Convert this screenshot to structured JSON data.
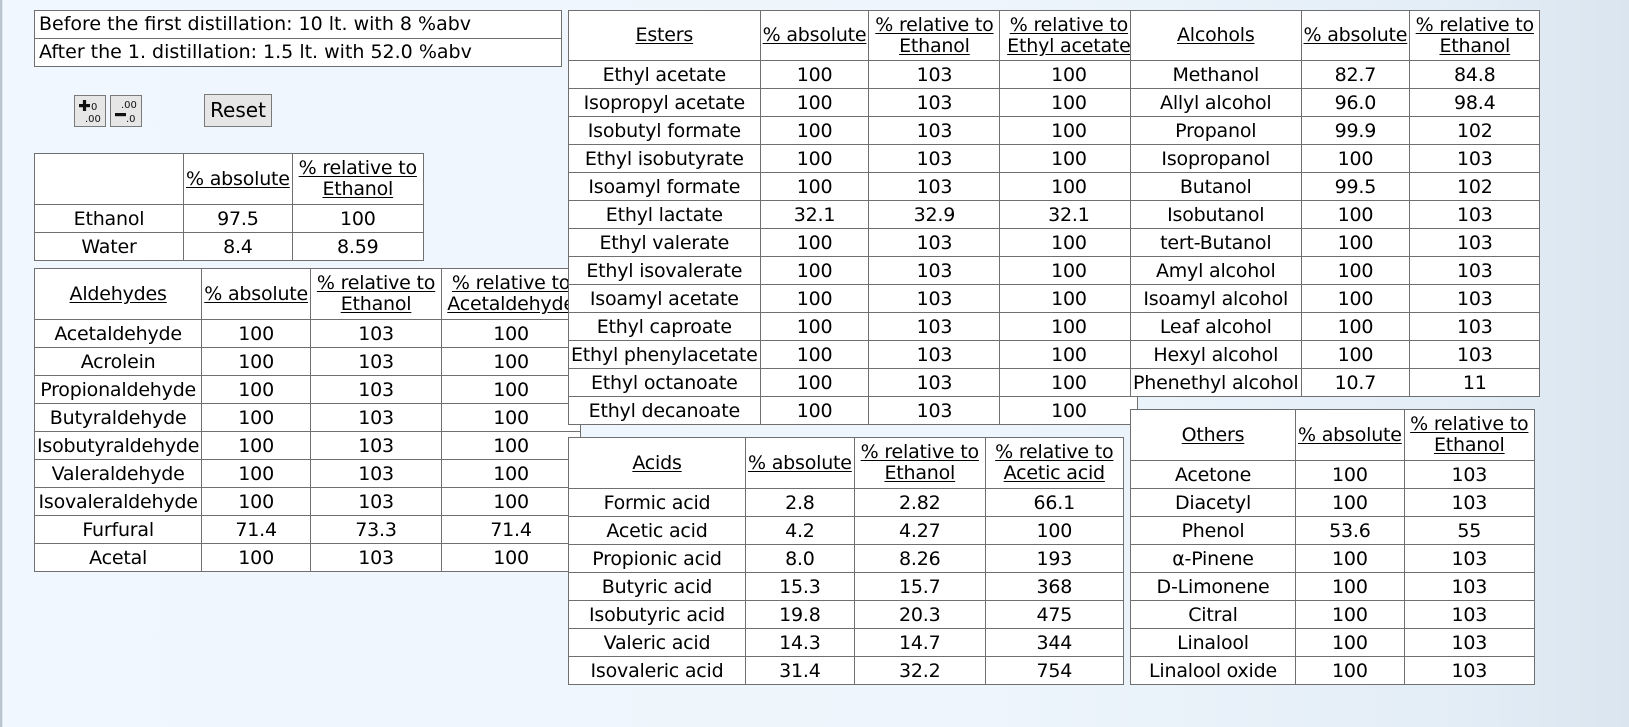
{
  "info": {
    "before": "Before the first distillation: 10 lt. with 8 %abv",
    "after": "After the 1. distillation: 1.5 lt. with 52.0 %abv"
  },
  "toolbar": {
    "increase_decimals_icon": "increase-decimal-icon",
    "decrease_decimals_icon": "decrease-decimal-icon",
    "reset_label": "Reset"
  },
  "ethanol_table": {
    "headers": [
      "",
      "% absolute",
      "% relative to",
      "Ethanol"
    ],
    "rows": [
      [
        "Ethanol",
        "97.5",
        "100"
      ],
      [
        "Water",
        "8.4",
        "8.59"
      ]
    ]
  },
  "aldehydes_table": {
    "title": "Aldehydes",
    "col_absolute": "% absolute",
    "col_rel1_top": "% relative to",
    "col_rel1_bottom": "Ethanol",
    "col_rel2_top": "% relative to",
    "col_rel2_bottom": "Acetaldehyde",
    "rows": [
      [
        "Acetaldehyde",
        "100",
        "103",
        "100"
      ],
      [
        "Acrolein",
        "100",
        "103",
        "100"
      ],
      [
        "Propionaldehyde",
        "100",
        "103",
        "100"
      ],
      [
        "Butyraldehyde",
        "100",
        "103",
        "100"
      ],
      [
        "Isobutyraldehyde",
        "100",
        "103",
        "100"
      ],
      [
        "Valeraldehyde",
        "100",
        "103",
        "100"
      ],
      [
        "Isovaleraldehyde",
        "100",
        "103",
        "100"
      ],
      [
        "Furfural",
        "71.4",
        "73.3",
        "71.4"
      ],
      [
        "Acetal",
        "100",
        "103",
        "100"
      ]
    ]
  },
  "esters_table": {
    "title": "Esters",
    "col_absolute": "% absolute",
    "col_rel1_top": "% relative to",
    "col_rel1_bottom": "Ethanol",
    "col_rel2_top": "% relative to",
    "col_rel2_bottom": "Ethyl acetate",
    "rows": [
      [
        "Ethyl acetate",
        "100",
        "103",
        "100"
      ],
      [
        "Isopropyl acetate",
        "100",
        "103",
        "100"
      ],
      [
        "Isobutyl formate",
        "100",
        "103",
        "100"
      ],
      [
        "Ethyl isobutyrate",
        "100",
        "103",
        "100"
      ],
      [
        "Isoamyl formate",
        "100",
        "103",
        "100"
      ],
      [
        "Ethyl lactate",
        "32.1",
        "32.9",
        "32.1"
      ],
      [
        "Ethyl valerate",
        "100",
        "103",
        "100"
      ],
      [
        "Ethyl isovalerate",
        "100",
        "103",
        "100"
      ],
      [
        "Isoamyl acetate",
        "100",
        "103",
        "100"
      ],
      [
        "Ethyl caproate",
        "100",
        "103",
        "100"
      ],
      [
        "Ethyl phenylacetate",
        "100",
        "103",
        "100"
      ],
      [
        "Ethyl octanoate",
        "100",
        "103",
        "100"
      ],
      [
        "Ethyl decanoate",
        "100",
        "103",
        "100"
      ]
    ]
  },
  "acids_table": {
    "title": "Acids",
    "col_absolute": "% absolute",
    "col_rel1_top": "% relative to",
    "col_rel1_bottom": "Ethanol",
    "col_rel2_top": "% relative to",
    "col_rel2_bottom": "Acetic acid",
    "rows": [
      [
        "Formic acid",
        "2.8",
        "2.82",
        "66.1"
      ],
      [
        "Acetic acid",
        "4.2",
        "4.27",
        "100"
      ],
      [
        "Propionic acid",
        "8.0",
        "8.26",
        "193"
      ],
      [
        "Butyric acid",
        "15.3",
        "15.7",
        "368"
      ],
      [
        "Isobutyric acid",
        "19.8",
        "20.3",
        "475"
      ],
      [
        "Valeric acid",
        "14.3",
        "14.7",
        "344"
      ],
      [
        "Isovaleric acid",
        "31.4",
        "32.2",
        "754"
      ]
    ]
  },
  "alcohols_table": {
    "title": "Alcohols",
    "col_absolute": "% absolute",
    "col_rel1_top": "% relative to",
    "col_rel1_bottom": "Ethanol",
    "rows": [
      [
        "Methanol",
        "82.7",
        "84.8"
      ],
      [
        "Allyl alcohol",
        "96.0",
        "98.4"
      ],
      [
        "Propanol",
        "99.9",
        "102"
      ],
      [
        "Isopropanol",
        "100",
        "103"
      ],
      [
        "Butanol",
        "99.5",
        "102"
      ],
      [
        "Isobutanol",
        "100",
        "103"
      ],
      [
        "tert-Butanol",
        "100",
        "103"
      ],
      [
        "Amyl alcohol",
        "100",
        "103"
      ],
      [
        "Isoamyl alcohol",
        "100",
        "103"
      ],
      [
        "Leaf alcohol",
        "100",
        "103"
      ],
      [
        "Hexyl alcohol",
        "100",
        "103"
      ],
      [
        "Phenethyl alcohol",
        "10.7",
        "11"
      ]
    ]
  },
  "others_table": {
    "title": "Others",
    "col_absolute": "% absolute",
    "col_rel1_top": "% relative to",
    "col_rel1_bottom": "Ethanol",
    "rows": [
      [
        "Acetone",
        "100",
        "103"
      ],
      [
        "Diacetyl",
        "100",
        "103"
      ],
      [
        "Phenol",
        "53.6",
        "55"
      ],
      [
        "α-Pinene",
        "100",
        "103"
      ],
      [
        "D-Limonene",
        "100",
        "103"
      ],
      [
        "Citral",
        "100",
        "103"
      ],
      [
        "Linalool",
        "100",
        "103"
      ],
      [
        "Linalool oxide",
        "100",
        "103"
      ]
    ]
  }
}
